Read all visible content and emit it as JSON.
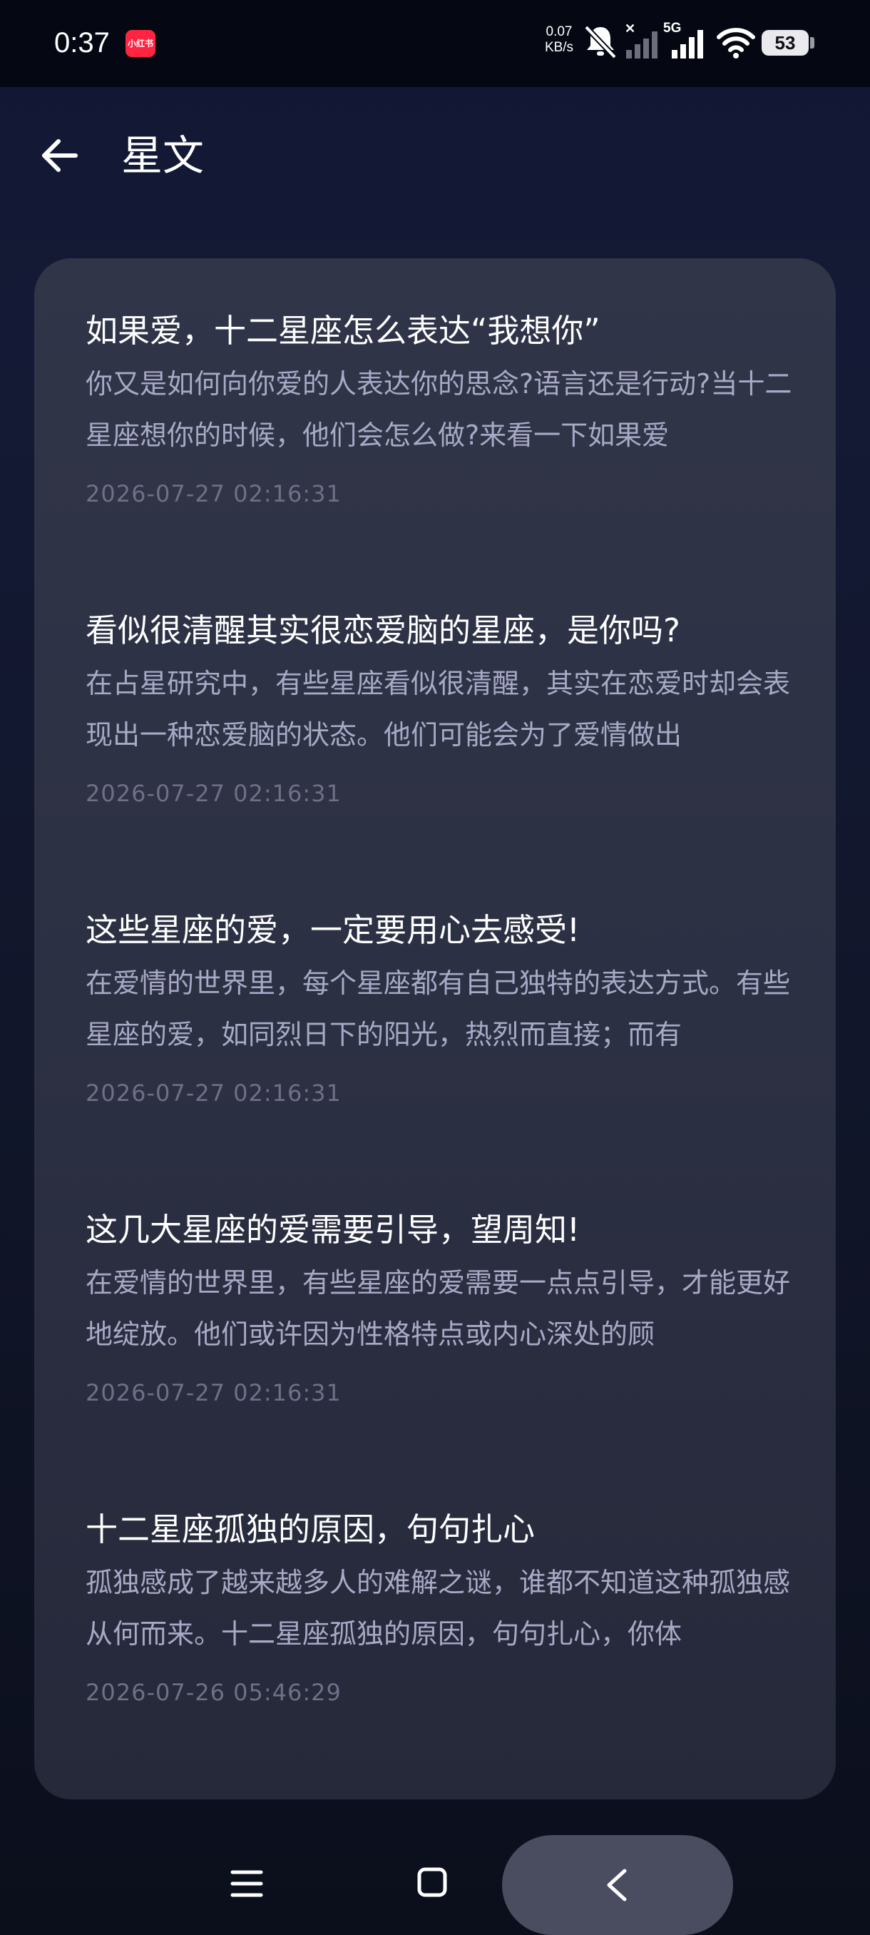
{
  "status_bar": {
    "time": "0:37",
    "app_badge": "小红书",
    "net_speed_value": "0.07",
    "net_speed_unit": "KB/s",
    "network_type": "5G",
    "battery": "53"
  },
  "header": {
    "title": "星文"
  },
  "articles": [
    {
      "title": "如果爱，十二星座怎么表达“我想你”",
      "summary": "你又是如何向你爱的人表达你的思念?语言还是行动?当十二星座想你的时候，他们会怎么做?来看一下如果爱",
      "date": "2026-07-27 02:16:31"
    },
    {
      "title": "看似很清醒其实很恋爱脑的星座，是你吗?",
      "summary": "在占星研究中，有些星座看似很清醒，其实在恋爱时却会表现出一种恋爱脑的状态。他们可能会为了爱情做出",
      "date": "2026-07-27 02:16:31"
    },
    {
      "title": "这些星座的爱，一定要用心去感受!",
      "summary": "在爱情的世界里，每个星座都有自己独特的表达方式。有些星座的爱，如同烈日下的阳光，热烈而直接；而有",
      "date": "2026-07-27 02:16:31"
    },
    {
      "title": "这几大星座的爱需要引导，望周知!",
      "summary": "在爱情的世界里，有些星座的爱需要一点点引导，才能更好地绽放。他们或许因为性格特点或内心深处的顾",
      "date": "2026-07-27 02:16:31"
    },
    {
      "title": "十二星座孤独的原因，句句扎心",
      "summary": "孤独感成了越来越多人的难解之谜，谁都不知道这种孤独感从何而来。十二星座孤独的原因，句句扎心，你体",
      "date": "2026-07-26 05:46:29"
    }
  ],
  "icons": {
    "back": "arrow-left-icon",
    "nav_menu": "menu-icon",
    "nav_home": "home-square-icon",
    "nav_back": "chevron-left-icon"
  },
  "colors": {
    "background": "#121833",
    "card": "#2e3245",
    "title_text": "#ffffff",
    "summary_text": "#a7a9c6",
    "date_text": "#6d7088",
    "app_badge": "#ff2442",
    "nav_pill": "#4a4d5f"
  }
}
